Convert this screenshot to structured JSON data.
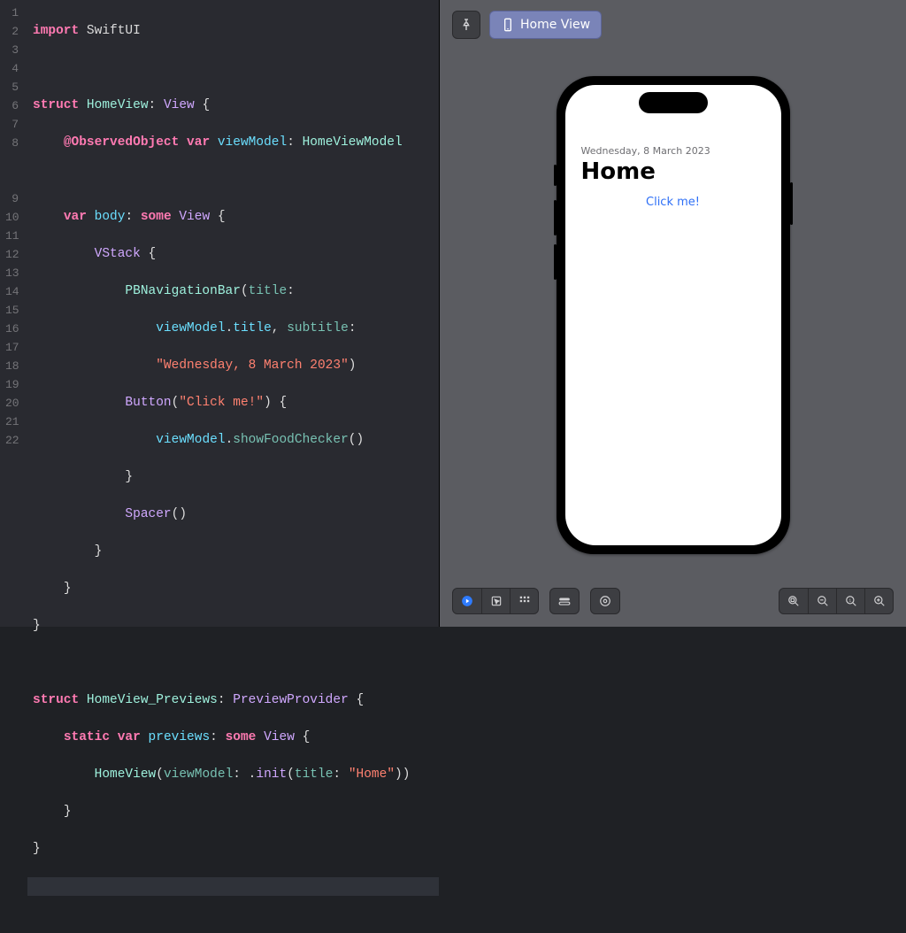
{
  "editor": {
    "line_count": 22,
    "tokens": {
      "import": "import",
      "struct": "struct",
      "var": "var",
      "some": "some",
      "static": "static",
      "SwiftUI": "SwiftUI",
      "HomeView": "HomeView",
      "View": "View",
      "ObservedObject": "@ObservedObject",
      "viewModel": "viewModel",
      "HomeViewModel": "HomeViewModel",
      "body": "body",
      "VStack": "VStack",
      "PBNavigationBar": "PBNavigationBar",
      "title_arg": "title",
      "title_prop": "title",
      "subtitle_arg": "subtitle",
      "date_str": "\"Wednesday, 8 March 2023\"",
      "Button": "Button",
      "click_str": "\"Click me!\"",
      "showFoodChecker": "showFoodChecker",
      "Spacer": "Spacer",
      "HomeView_Previews": "HomeView_Previews",
      "PreviewProvider": "PreviewProvider",
      "previews": "previews",
      "init": "init",
      "home_str": "\"Home\""
    }
  },
  "preview": {
    "chip_label": "Home View",
    "app": {
      "subtitle": "Wednesday, 8 March 2023",
      "title": "Home",
      "button": "Click me!"
    }
  },
  "icons": {
    "pin": "pin-icon",
    "phone": "phone-icon",
    "play": "play-icon",
    "cursor": "cursor-icon",
    "grid": "grid-icon",
    "device_toggle": "device-toggle-icon",
    "variants": "variants-icon",
    "zoom_out_full": "zoom-fit-icon",
    "zoom_out": "zoom-out-icon",
    "zoom_actual": "zoom-100-icon",
    "zoom_in": "zoom-in-icon"
  }
}
